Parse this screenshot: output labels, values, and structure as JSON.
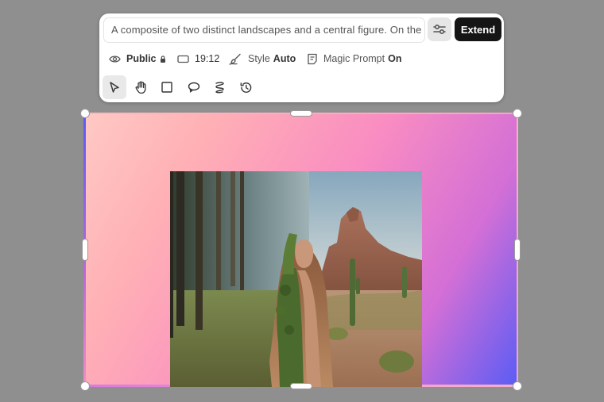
{
  "prompt": {
    "text": "A composite of two distinct landscapes and a central figure. On the left, the forest is dense and shaded while on the right a desert with rocky cliffs and cactus",
    "extend_label": "Extend",
    "settings_icon": "sliders-icon"
  },
  "options": {
    "visibility": {
      "label": "Public",
      "icon": "eye-icon"
    },
    "aspect_ratio": {
      "value": "19:12",
      "icon": "rectangle-icon"
    },
    "style": {
      "label": "Style",
      "value": "Auto",
      "icon": "brush-icon"
    },
    "magic_prompt": {
      "label": "Magic Prompt",
      "value": "On",
      "icon": "document-icon"
    }
  },
  "tools": [
    {
      "name": "select",
      "icon": "cursor-icon",
      "active": true
    },
    {
      "name": "pan",
      "icon": "hand-icon",
      "active": false
    },
    {
      "name": "rectangle",
      "icon": "square-icon",
      "active": false
    },
    {
      "name": "lasso",
      "icon": "lasso-icon",
      "active": false
    },
    {
      "name": "brush",
      "icon": "scribble-icon",
      "active": false
    },
    {
      "name": "history",
      "icon": "history-icon",
      "active": false
    }
  ],
  "colors": {
    "accent_dark": "#151515",
    "background": "#8f8f8f",
    "gradient": [
      "#ffc9c4",
      "#f98cc2",
      "#d36fd6",
      "#5a5cf5"
    ]
  }
}
